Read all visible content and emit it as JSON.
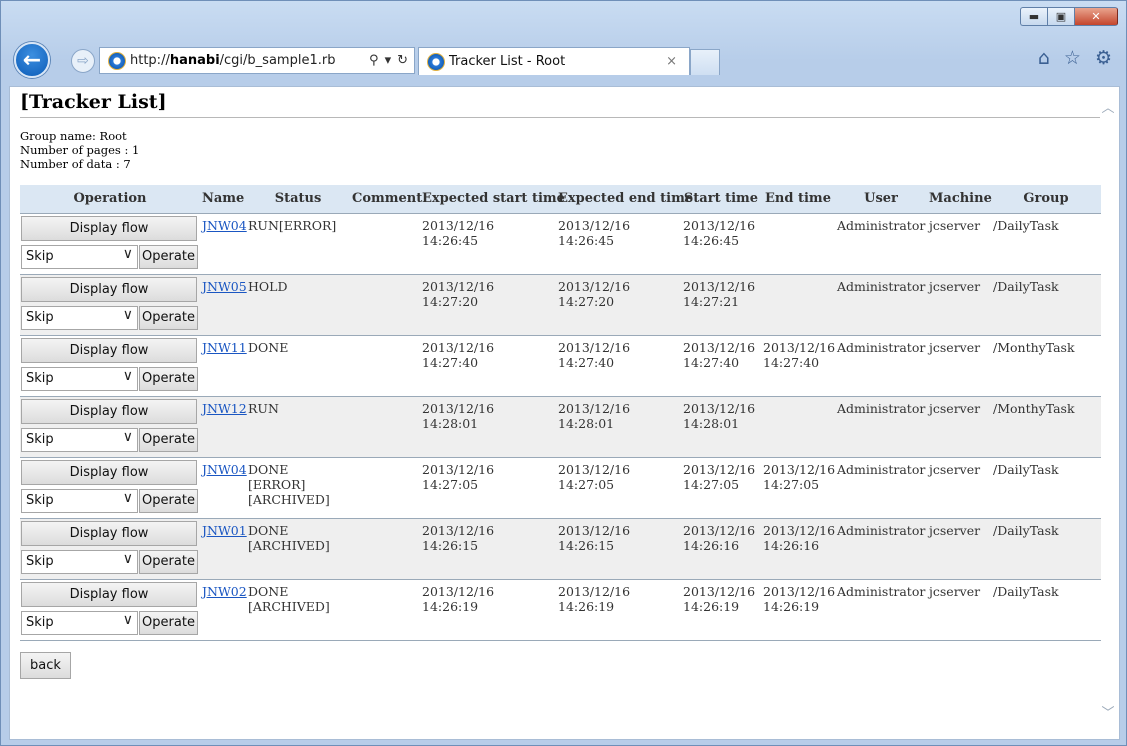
{
  "browser": {
    "url_prefix": "http://",
    "url_host": "hanabi",
    "url_path": "/cgi/b_sample1.rb",
    "tab_title": "Tracker List - Root",
    "tab_close": "×",
    "search_glyph": "⚲",
    "refresh_glyph": "↻",
    "dropdown_glyph": "▾",
    "back_glyph": "←",
    "forward_glyph": "⇨",
    "home_glyph": "⌂",
    "favorites_glyph": "☆",
    "tools_glyph": "⚙",
    "minimize_glyph": "▬",
    "maximize_glyph": "▣",
    "close_glyph": "✕",
    "icons": [
      "back-icon",
      "forward-icon",
      "ie-logo-icon",
      "search-icon",
      "refresh-icon",
      "home-icon",
      "favorites-icon",
      "gear-icon"
    ]
  },
  "page": {
    "title": "[Tracker List]",
    "group_name": "Group name: Root",
    "pages": "Number of pages : 1",
    "data_count": "Number of data : 7",
    "back_label": "back",
    "scroll_up": "︿",
    "scroll_down": "﹀"
  },
  "table": {
    "headers": [
      "Operation",
      "Name",
      "Status",
      "Comment",
      "Expected start time",
      "Expected end time",
      "Start time",
      "End time",
      "User",
      "Machine",
      "Group"
    ],
    "display_flow_label": "Display flow",
    "select_value": "Skip",
    "select_chevron": "∨",
    "operate_label": "Operate",
    "rows": [
      {
        "name": "JNW04",
        "status": "RUN[ERROR]",
        "comment": "",
        "exp_start": "2013/12/16 14:26:45",
        "exp_end": "2013/12/16 14:26:45",
        "start": "2013/12/16 14:26:45",
        "end": "",
        "user": "Administrator",
        "machine": "jcserver",
        "group": "/DailyTask"
      },
      {
        "name": "JNW05",
        "status": "HOLD",
        "comment": "",
        "exp_start": "2013/12/16 14:27:20",
        "exp_end": "2013/12/16 14:27:20",
        "start": "2013/12/16 14:27:21",
        "end": "",
        "user": "Administrator",
        "machine": "jcserver",
        "group": "/DailyTask"
      },
      {
        "name": "JNW11",
        "status": "DONE",
        "comment": "",
        "exp_start": "2013/12/16 14:27:40",
        "exp_end": "2013/12/16 14:27:40",
        "start": "2013/12/16 14:27:40",
        "end": "2013/12/16 14:27:40",
        "user": "Administrator",
        "machine": "jcserver",
        "group": "/MonthyTask"
      },
      {
        "name": "JNW12",
        "status": "RUN",
        "comment": "",
        "exp_start": "2013/12/16 14:28:01",
        "exp_end": "2013/12/16 14:28:01",
        "start": "2013/12/16 14:28:01",
        "end": "",
        "user": "Administrator",
        "machine": "jcserver",
        "group": "/MonthyTask"
      },
      {
        "name": "JNW04",
        "status": "DONE [ERROR] [ARCHIVED]",
        "comment": "",
        "exp_start": "2013/12/16 14:27:05",
        "exp_end": "2013/12/16 14:27:05",
        "start": "2013/12/16 14:27:05",
        "end": "2013/12/16 14:27:05",
        "user": "Administrator",
        "machine": "jcserver",
        "group": "/DailyTask"
      },
      {
        "name": "JNW01",
        "status": "DONE [ARCHIVED]",
        "comment": "",
        "exp_start": "2013/12/16 14:26:15",
        "exp_end": "2013/12/16 14:26:15",
        "start": "2013/12/16 14:26:16",
        "end": "2013/12/16 14:26:16",
        "user": "Administrator",
        "machine": "jcserver",
        "group": "/DailyTask"
      },
      {
        "name": "JNW02",
        "status": "DONE [ARCHIVED]",
        "comment": "",
        "exp_start": "2013/12/16 14:26:19",
        "exp_end": "2013/12/16 14:26:19",
        "start": "2013/12/16 14:26:19",
        "end": "2013/12/16 14:26:19",
        "user": "Administrator",
        "machine": "jcserver",
        "group": "/DailyTask"
      }
    ]
  }
}
